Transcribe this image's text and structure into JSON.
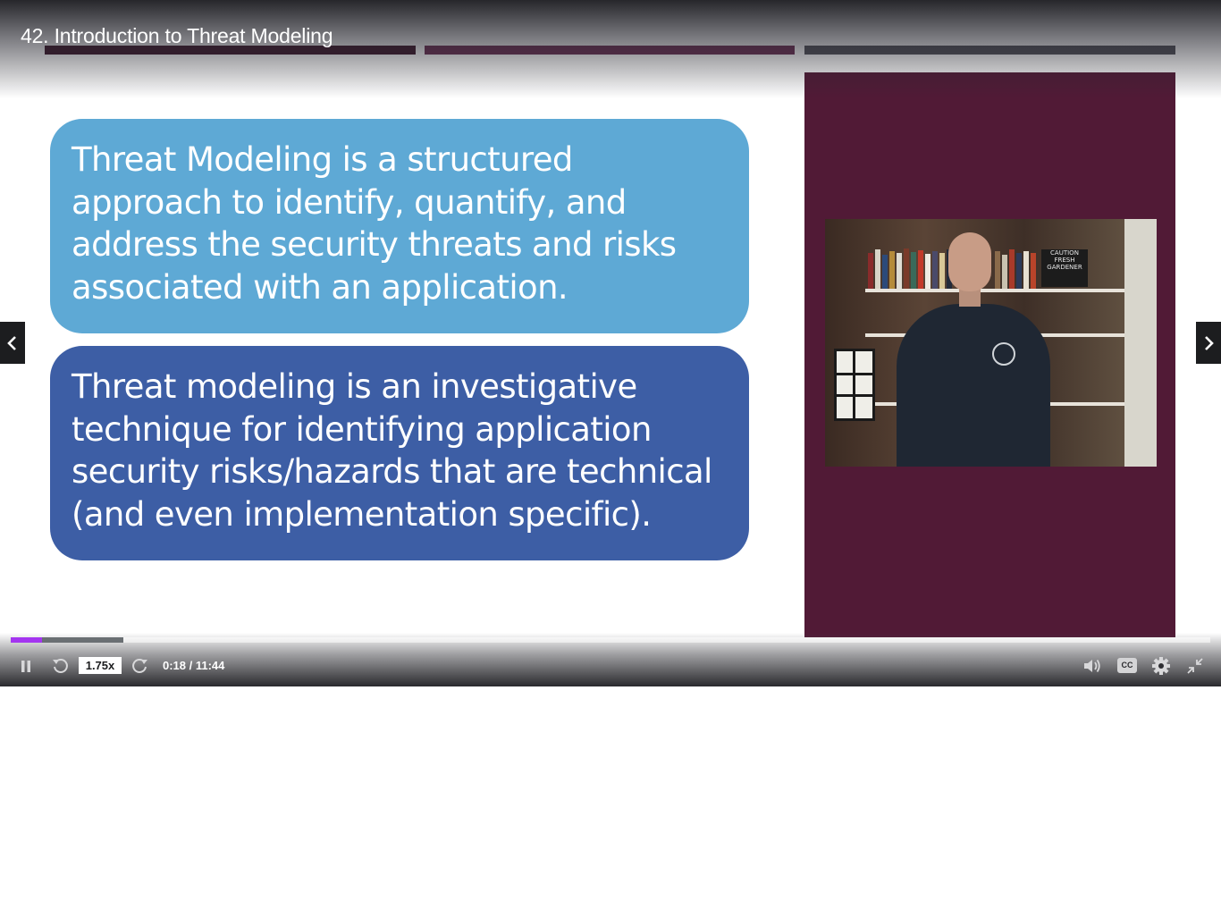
{
  "player": {
    "lecture_title": "42. Introduction to Threat Modeling",
    "slide": {
      "box1_lines": [
        "Threat Modeling is a structured",
        "approach to identify, quantify, and",
        "address the security threats and risks",
        "associated with an application."
      ],
      "box2_lines": [
        "Threat modeling is an investigative",
        "technique for identifying application",
        "security risks/hazards that are technical",
        "(and even implementation specific)."
      ],
      "video_sign": [
        "CAUTION",
        "FRESH",
        "GARDENER"
      ]
    },
    "nav": {
      "prev_icon": "chevron-left-icon",
      "next_icon": "chevron-right-icon"
    },
    "controls": {
      "playback_speed": "1.75x",
      "time_display": "0:18 / 11:44",
      "cc_label": "CC",
      "progress_played_fraction": 0.026,
      "progress_buffered_fraction": 0.094
    },
    "colors": {
      "accent_progress": "#a435f0",
      "box1": "#5ea9d5",
      "box2": "#3d5ea5",
      "video_panel": "#511a36"
    }
  }
}
